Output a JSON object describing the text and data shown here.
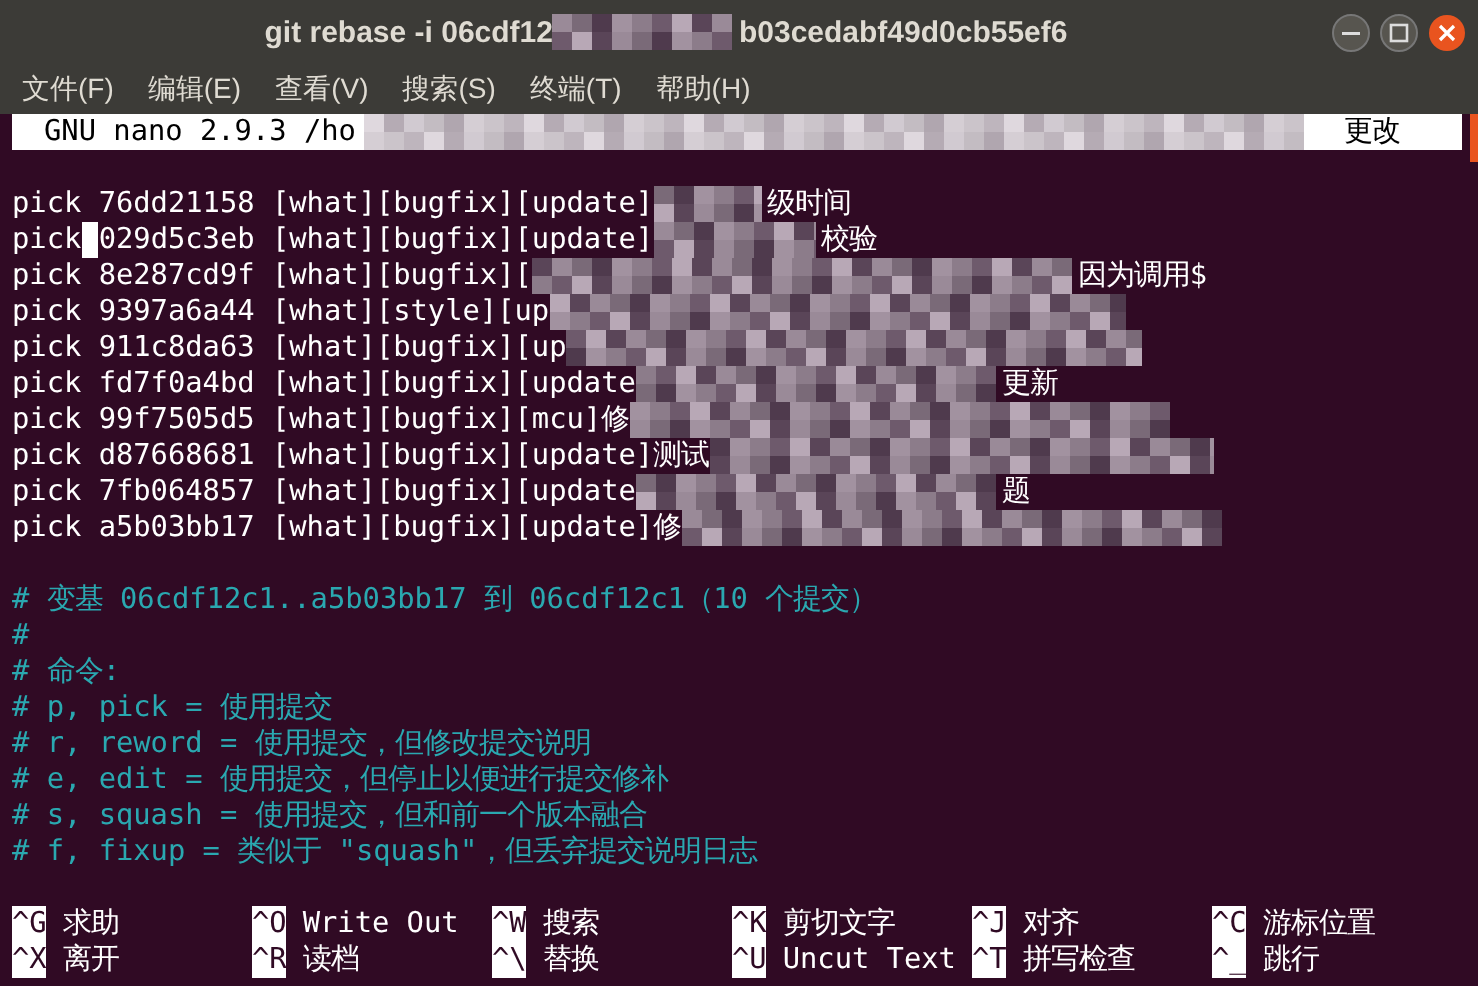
{
  "window": {
    "title_start": "git rebase -i 06cdf12",
    "title_end": "b03cedabf49d0cb55ef6"
  },
  "menu": [
    "文件(F)",
    "编辑(E)",
    "查看(V)",
    "搜索(S)",
    "终端(T)",
    "帮助(H)"
  ],
  "nano_header": {
    "start": "GNU nano 2.9.3 /ho",
    "end": "更改"
  },
  "commits": [
    {
      "text": "pick 76dd21158 [what][bugfix][update]",
      "tail": "级时间",
      "cursor": false
    },
    {
      "text": "pick 029d5c3eb [what][bugfix][update]",
      "tail": "校验",
      "cursor": true
    },
    {
      "text": "pick 8e287cd9f [what][bugfix][",
      "tail": "因为调用$",
      "cursor": false
    },
    {
      "text": "pick 9397a6a44 [what][style][up",
      "cursor": false
    },
    {
      "text": "pick 911c8da63 [what][bugfix][up",
      "cursor": false
    },
    {
      "text": "pick fd7f0a4bd [what][bugfix][update",
      "tail": "更新",
      "cursor": false
    },
    {
      "text": "pick 99f7505d5 [what][bugfix][mcu]修",
      "cursor": false
    },
    {
      "text": "pick d87668681 [what][bugfix][update]测试",
      "cursor": false
    },
    {
      "text": "pick 7fb064857 [what][bugfix][update",
      "tail": "题",
      "cursor": false
    },
    {
      "text": "pick a5b03bb17 [what][bugfix][update]修",
      "cursor": false
    }
  ],
  "comments": [
    "# 变基 06cdf12c1..a5b03bb17 到 06cdf12c1（10 个提交）",
    "#",
    "# 命令:",
    "# p, pick = 使用提交",
    "# r, reword = 使用提交，但修改提交说明",
    "# e, edit = 使用提交，但停止以便进行提交修补",
    "# s, squash = 使用提交，但和前一个版本融合",
    "# f, fixup = 类似于 \"squash\"，但丢弃提交说明日志"
  ],
  "shortcuts": [
    [
      {
        "key": "^G",
        "label": "求助"
      },
      {
        "key": "^O",
        "label": "Write Out"
      },
      {
        "key": "^W",
        "label": "搜索"
      },
      {
        "key": "^K",
        "label": "剪切文字"
      },
      {
        "key": "^J",
        "label": "对齐"
      },
      {
        "key": "^C",
        "label": "游标位置"
      }
    ],
    [
      {
        "key": "^X",
        "label": "离开"
      },
      {
        "key": "^R",
        "label": "读档"
      },
      {
        "key": "^\\",
        "label": "替换"
      },
      {
        "key": "^U",
        "label": "Uncut Text"
      },
      {
        "key": "^T",
        "label": "拼写检查"
      },
      {
        "key": "^_",
        "label": "跳行"
      }
    ]
  ]
}
